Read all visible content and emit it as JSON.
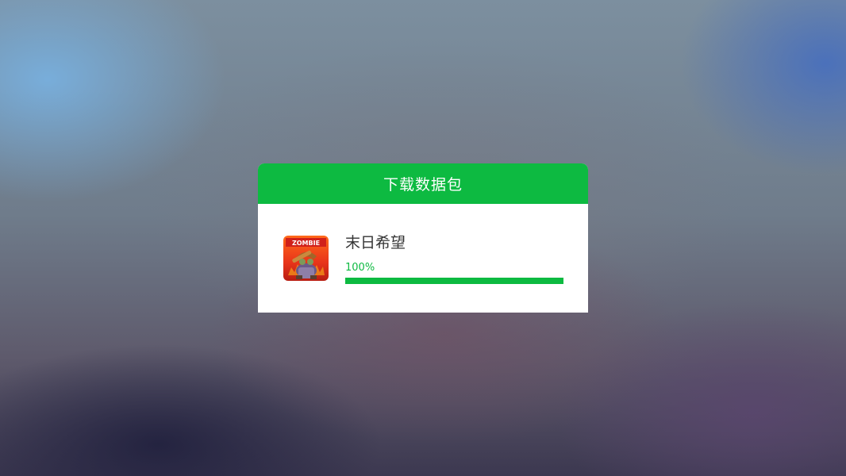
{
  "dialog": {
    "title": "下载数据包",
    "accent_color": "#0dba41"
  },
  "download": {
    "app_name": "末日希望",
    "app_icon": "zombie-game-icon",
    "icon_text": "ZOMBIE",
    "progress_text": "100%",
    "progress_fraction": 1.0
  }
}
